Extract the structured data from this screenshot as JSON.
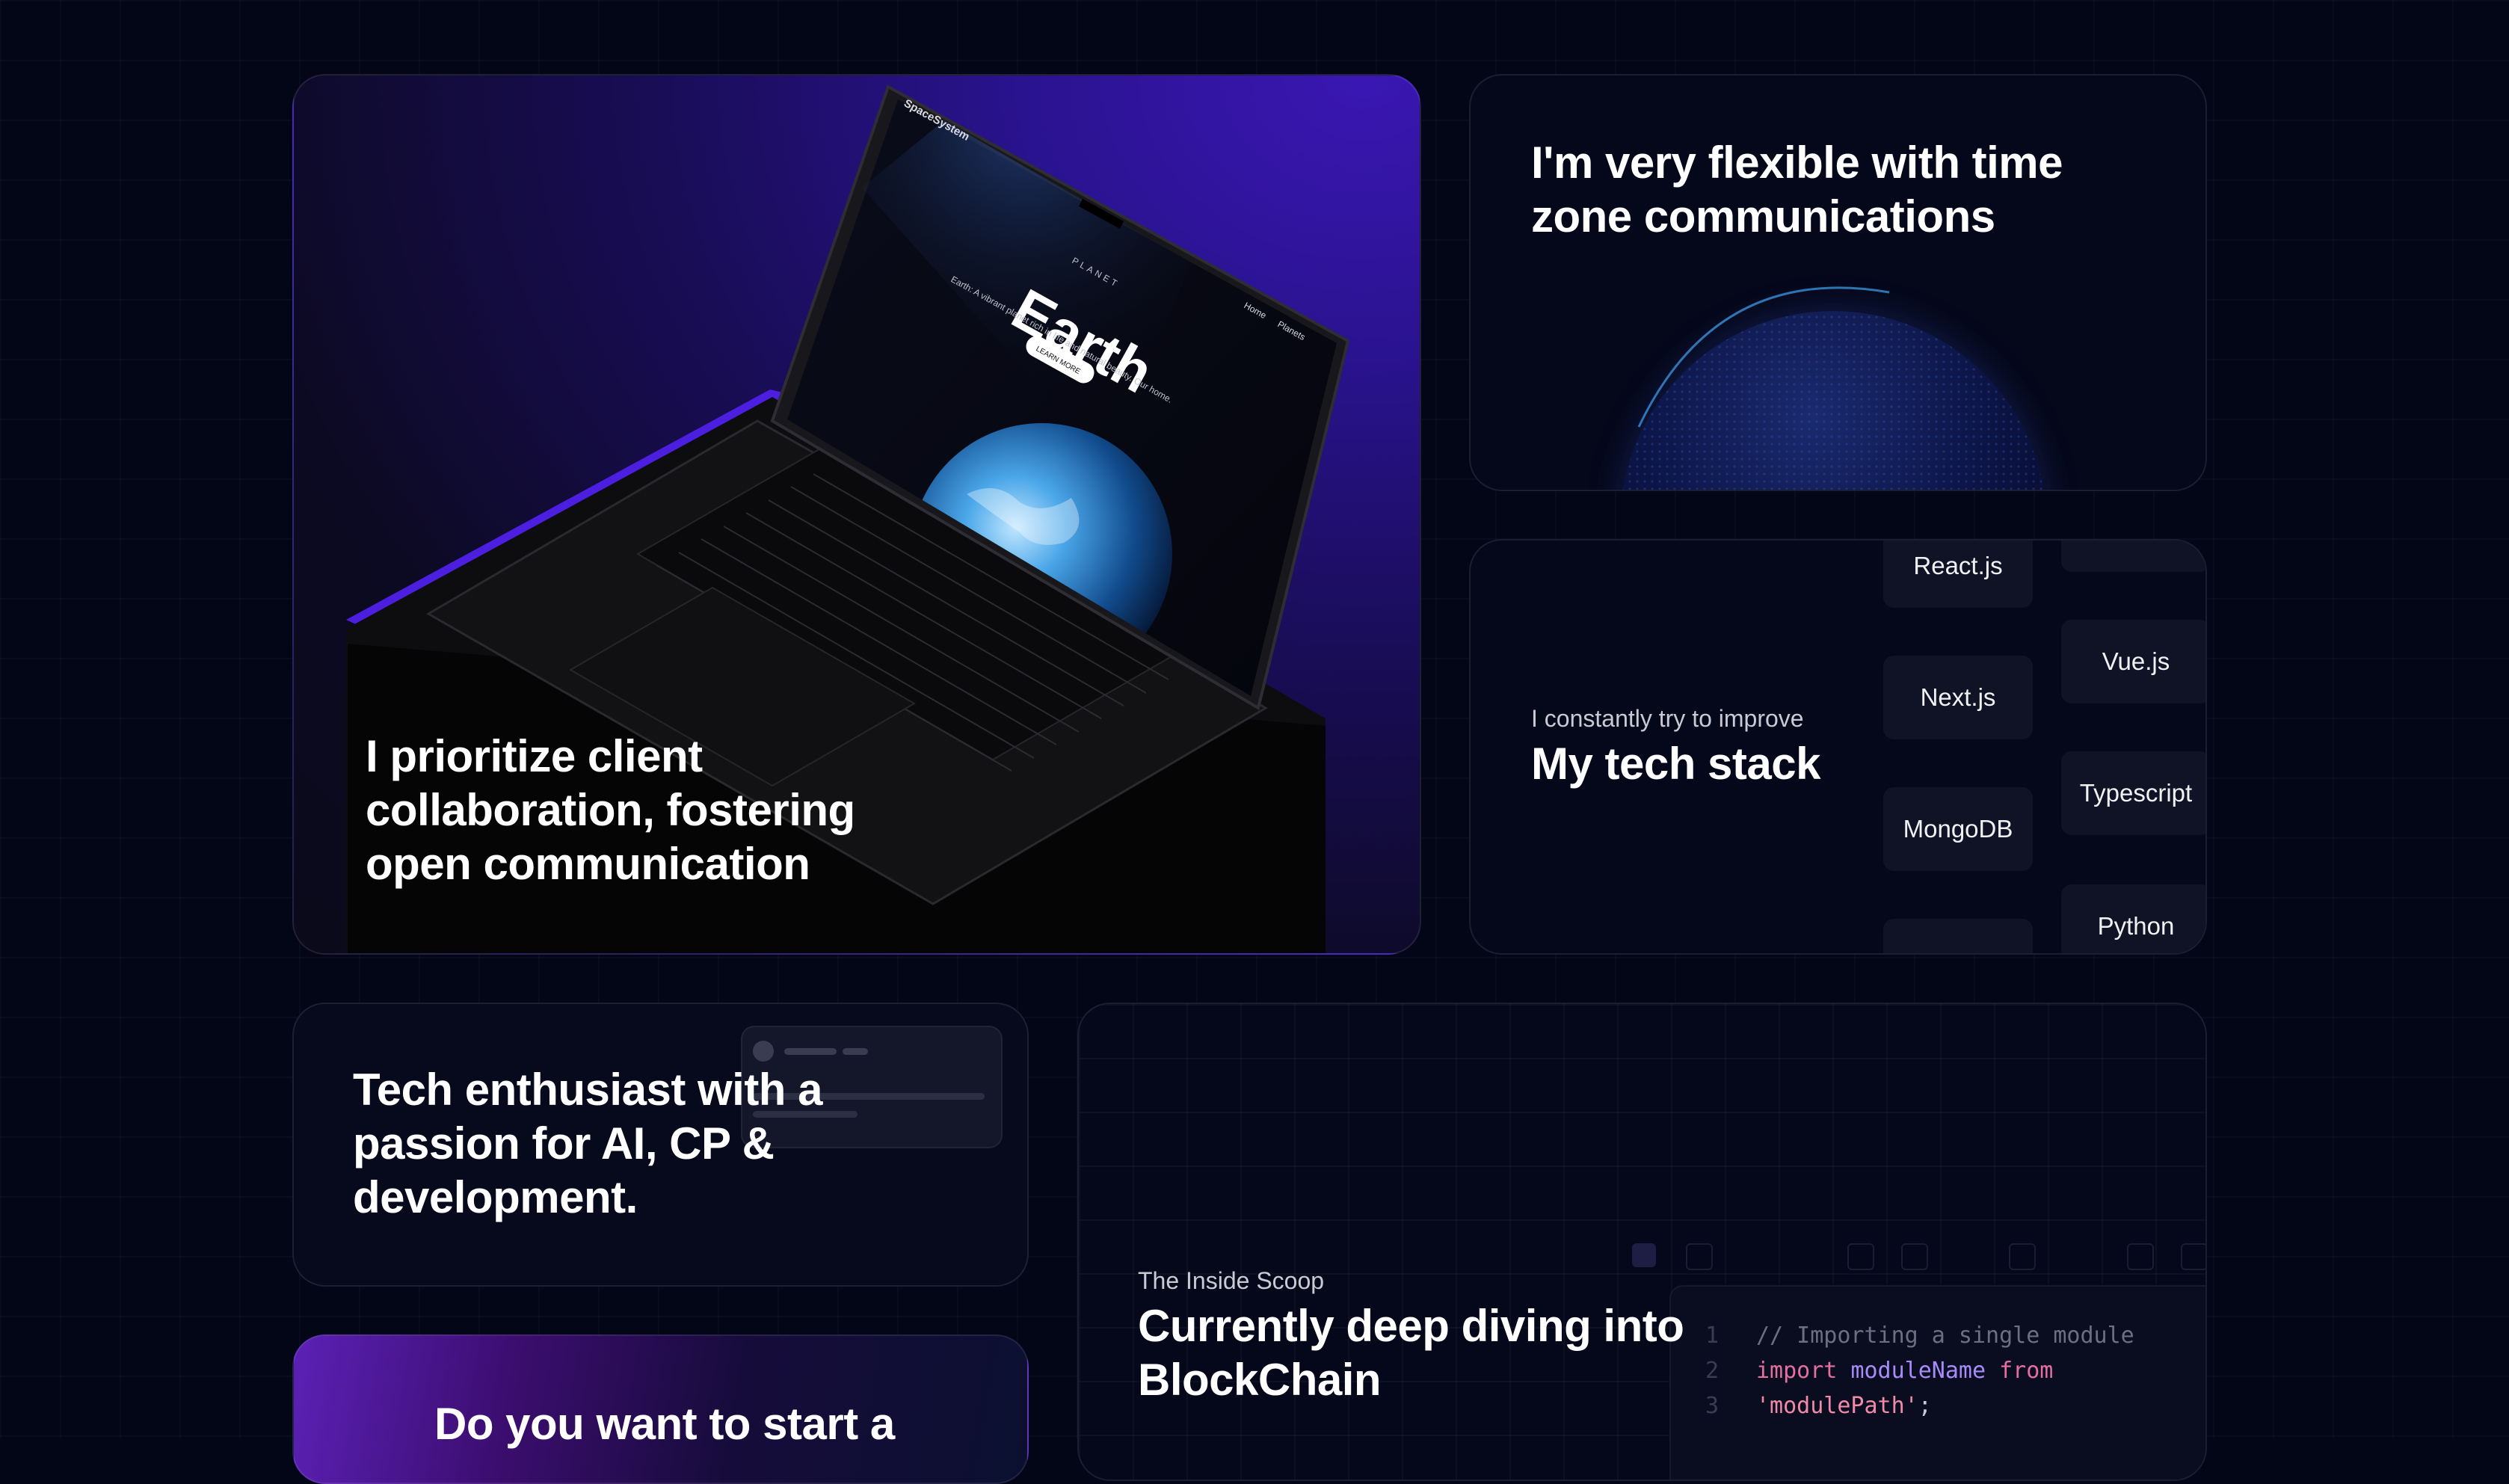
{
  "collab": {
    "heading_lines": [
      "I prioritize client",
      "collaboration, fostering",
      "open communication"
    ],
    "laptop_screen": {
      "brand": "SpaceSystem",
      "nav": [
        "Home",
        "Planets"
      ],
      "kicker": "PLANET",
      "title": "Earth",
      "tagline": "Earth: A vibrant planet rich in life and natural beauty. Our home.",
      "button": "LEARN MORE"
    }
  },
  "timezone": {
    "heading_lines": [
      "I'm very flexible with time",
      "zone communications"
    ]
  },
  "stack": {
    "subtitle": "I constantly try to improve",
    "title": "My tech stack",
    "items": [
      "React.js",
      "Vue.js",
      "Next.js",
      "Typescript",
      "MongoDB",
      "Python"
    ]
  },
  "enthusiast": {
    "heading_lines": [
      "Tech enthusiast with a",
      "passion for AI, CP &",
      "development."
    ]
  },
  "blockchain": {
    "subtitle": "The Inside Scoop",
    "heading_lines": [
      "Currently deep diving into",
      "BlockChain"
    ],
    "code": {
      "line_numbers": [
        "1",
        "2",
        "3"
      ],
      "comment": "// Importing a single module",
      "keyword_import": "import",
      "identifier": "moduleName",
      "keyword_from": "from",
      "string": "'modulePath'",
      "semicolon": ";"
    }
  },
  "cta": {
    "heading": "Do you want to start a"
  },
  "colors": {
    "background": "#030617",
    "accent_purple": "#4c1fe0",
    "code_keyword": "#e46fa0",
    "code_identifier": "#a78bfa",
    "code_comment": "#6b6f82"
  }
}
